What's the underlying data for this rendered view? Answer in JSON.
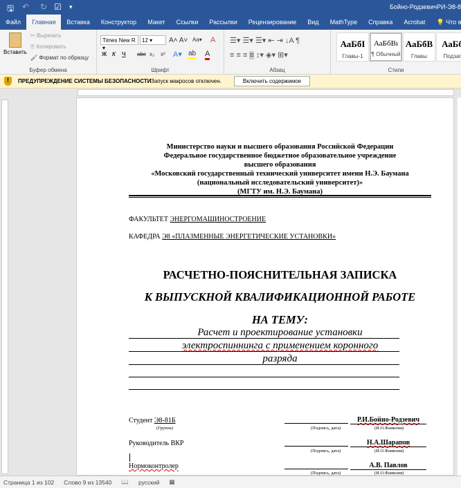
{
  "titlebar": {
    "document_title": "Бойно-РодзевичРИ-Э8-8"
  },
  "tabs": [
    "Файл",
    "Главная",
    "Вставка",
    "Конструктор",
    "Макет",
    "Ссылки",
    "Рассылки",
    "Рецензирование",
    "Вид",
    "MathType",
    "Справка",
    "Acrobat"
  ],
  "tell_me": "Что вы х",
  "clipboard": {
    "paste": "Вставить",
    "cut": "Вырезать",
    "copy": "Копировать",
    "format_painter": "Формат по образцу",
    "label": "Буфер обмена"
  },
  "font": {
    "name": "Times New R",
    "size": "12",
    "label": "Шрифт",
    "bold": "Ж",
    "italic": "К",
    "underline": "Ч",
    "strike": "abc",
    "sub": "x₂",
    "sup": "x²",
    "case": "Aa"
  },
  "paragraph": {
    "label": "Абзац"
  },
  "styles": {
    "label": "Стили",
    "items": [
      {
        "sample": "АаБбI",
        "name": "Главы-1"
      },
      {
        "sample": "АаБбВı",
        "name": "¶ Обычный"
      },
      {
        "sample": "АаБбВ",
        "name": "Главы"
      },
      {
        "sample": "АаБб",
        "name": "Подзаг"
      }
    ]
  },
  "security": {
    "title": "ПРЕДУПРЕЖДЕНИЕ СИСТЕМЫ БЕЗОПАСНОСТИ",
    "message": "Запуск макросов отключен.",
    "button": "Включить содержимое"
  },
  "doc": {
    "header": [
      "Министерство науки и высшего образования Российской Федерации",
      "Федеральное государственное бюджетное образовательное учреждение",
      "высшего образования",
      "«Московский государственный технический университет имени Н.Э. Баумана",
      "(национальный исследовательский университет)»",
      "(МГТУ им. Н.Э. Баумана)"
    ],
    "faculty_label": "ФАКУЛЬТЕТ",
    "faculty": "ЭНЕРГОМАШИНОСТРОЕНИЕ",
    "department_label": "КАФЕДРА",
    "department": "Э8 «ПЛАЗМЕННЫЕ ЭНЕРГЕТИЧЕСКИЕ УСТАНОВКИ»",
    "title1": "РАСЧЕТНО-ПОЯСНИТЕЛЬНАЯ ЗАПИСКА",
    "title2": "К ВЫПУСКНОЙ КВАЛИФИКАЦИОННОЙ РАБОТЕ",
    "title3": "НА ТЕМУ:",
    "topic": [
      "Расчет и проектирование установки",
      "электроспиннинга с применением коронного",
      "разряда"
    ],
    "student_label": "Студент",
    "group": "Э8-81Б",
    "group_caption": "(Группа)",
    "student_name": "Р.И.Бойно-Родзевич",
    "supervisor_label": "Руководитель ВКР",
    "supervisor_name": "Н.А.Шарапов",
    "normcontrol_label": "Нормоконтролер",
    "normcontrol_name": "А.В. Павлов",
    "sign_caption": "(Подпись, дата)",
    "name_caption": "(И.О.Фамилия)"
  },
  "status": {
    "page": "Страница 1 из 102",
    "words": "Слово 9 из 13540",
    "language": "русский"
  }
}
